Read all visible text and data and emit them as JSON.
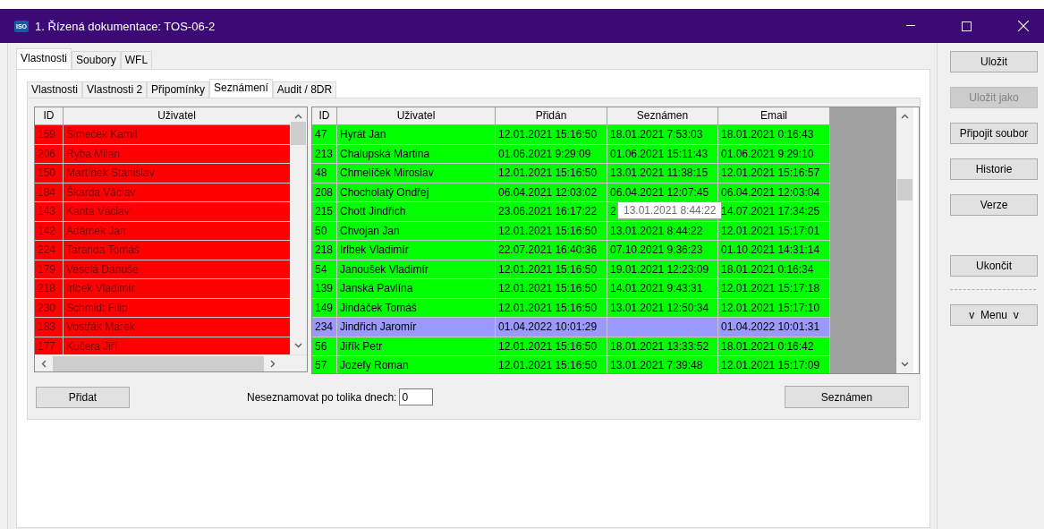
{
  "window": {
    "icon_text": "ISO",
    "title": "1. Řízená dokumentace: TOS-06-2"
  },
  "tabs": [
    {
      "label": "Vlastnosti",
      "selected": true
    },
    {
      "label": "Soubory",
      "selected": false
    },
    {
      "label": "WFL",
      "selected": false
    }
  ],
  "subtabs": [
    {
      "label": "Vlastnosti",
      "selected": false
    },
    {
      "label": "Vlastnosti 2",
      "selected": false
    },
    {
      "label": "Připomínky",
      "selected": false
    },
    {
      "label": "Seznámení",
      "selected": true
    },
    {
      "label": "Audit / 8DR",
      "selected": false
    }
  ],
  "assigned_table": {
    "columns": [
      "ID",
      "Uživatel"
    ],
    "rows": [
      {
        "cells": [
          "159",
          "Šimeček Kamil"
        ],
        "color": "#ff0000"
      },
      {
        "cells": [
          "206",
          "Ryba Milan"
        ],
        "color": "#ff0000"
      },
      {
        "cells": [
          "150",
          "Martínek Stanislav"
        ],
        "color": "#ff0000"
      },
      {
        "cells": [
          "184",
          "Škarda Václav"
        ],
        "color": "#ff0000"
      },
      {
        "cells": [
          "143",
          "Kanta Václav"
        ],
        "color": "#ff0000"
      },
      {
        "cells": [
          "142",
          "Adámek Jan"
        ],
        "color": "#ff0000"
      },
      {
        "cells": [
          "224",
          "Taranda Tomáš"
        ],
        "color": "#ff0000"
      },
      {
        "cells": [
          "179",
          "Veselá Danuše"
        ],
        "color": "#ff0000"
      },
      {
        "cells": [
          "218",
          "Irlbek Vladimír"
        ],
        "color": "#ff0000"
      },
      {
        "cells": [
          "230",
          "Schmidt Filip"
        ],
        "color": "#ff0000"
      },
      {
        "cells": [
          "183",
          "Vostřák Marek"
        ],
        "color": "#ff0000"
      },
      {
        "cells": [
          "177",
          "Kučera Jiří"
        ],
        "color": "#ff0000"
      }
    ]
  },
  "users_table": {
    "columns": [
      "ID",
      "Uživatel",
      "Přidán",
      "Seznámen",
      "Email"
    ],
    "rows": [
      {
        "cells": [
          "47",
          "Hyrát Jan",
          "12.01.2021 15:16:50",
          "18.01.2021 7:53:03",
          "18.01.2021 0:16:43"
        ],
        "color": "#00ff00"
      },
      {
        "cells": [
          "213",
          "Chalupská Martina",
          "01.06.2021 9:29:09",
          "01.06.2021 15:11:43",
          "01.06.2021 9:29:10"
        ],
        "color": "#00ff00"
      },
      {
        "cells": [
          "48",
          "Chmelíček Miroslav",
          "12.01.2021 15:16:50",
          "13.01.2021 11:38:15",
          "12.01.2021 15:16:57"
        ],
        "color": "#00ff00"
      },
      {
        "cells": [
          "208",
          "Chocholatý Ondřej",
          "06.04.2021 12:03:02",
          "06.04.2021 12:07:45",
          "06.04.2021 12:03:04"
        ],
        "color": "#00ff00"
      },
      {
        "cells": [
          "215",
          "Chott Jindřich",
          "23.06.2021 16:17:22",
          "2",
          "14.07.2021 17:34:25"
        ],
        "color": "#00ff00"
      },
      {
        "cells": [
          "50",
          "Chvojan Jan",
          "12.01.2021 15:16:50",
          "13.01.2021 8:44:22",
          "12.01.2021 15:17:01"
        ],
        "color": "#00ff00"
      },
      {
        "cells": [
          "218",
          "Irlbek Vladimír",
          "22.07.2021 16:40:36",
          "07.10.2021 9:36:23",
          "01.10.2021 14:31:14"
        ],
        "color": "#00ff00"
      },
      {
        "cells": [
          "54",
          "Janoušek Vladimír",
          "12.01.2021 15:16:50",
          "19.01.2021 12:23:09",
          "18.01.2021 0:16:34"
        ],
        "color": "#00ff00"
      },
      {
        "cells": [
          "139",
          "Janská Pavlína",
          "12.01.2021 15:16:50",
          "14.01.2021 9:43:31",
          "12.01.2021 15:17:18"
        ],
        "color": "#00ff00"
      },
      {
        "cells": [
          "149",
          "Jindáček Tomáš",
          "12.01.2021 15:16:50",
          "13.01.2021 12:50:34",
          "12.01.2021 15:17:10"
        ],
        "color": "#00ff00"
      },
      {
        "cells": [
          "234",
          "Jindřich Jaromír",
          "01.04.2022 10:01:29",
          "",
          "01.04.2022 10:01:31"
        ],
        "color": "#9999ff"
      },
      {
        "cells": [
          "56",
          "Jiřík Petr",
          "12.01.2021 15:16:50",
          "18.01.2021 13:33:52",
          "18.01.2021 0:16:42"
        ],
        "color": "#00ff00"
      },
      {
        "cells": [
          "57",
          "Jozefy Roman",
          "12.01.2021 15:16:50",
          "13.01.2021 7:39:48",
          "12.01.2021 15:17:09"
        ],
        "color": "#00ff00"
      }
    ]
  },
  "tooltip": "13.01.2021 8:44:22",
  "add_button": "Přidat",
  "days_field": {
    "label": "Neseznamovat po tolika dnech:",
    "value": "0"
  },
  "acknowledge_button": "Seznámen",
  "side_buttons": [
    {
      "label": "Uložit",
      "disabled": false
    },
    {
      "label": "Uložit jako",
      "disabled": true
    },
    {
      "label": "Připojit soubor",
      "disabled": false
    },
    {
      "label": "Historie",
      "disabled": false
    },
    {
      "label": "Verze",
      "disabled": false
    }
  ],
  "exit_button": "Ukončit",
  "menu_button": "v  Menu  v"
}
